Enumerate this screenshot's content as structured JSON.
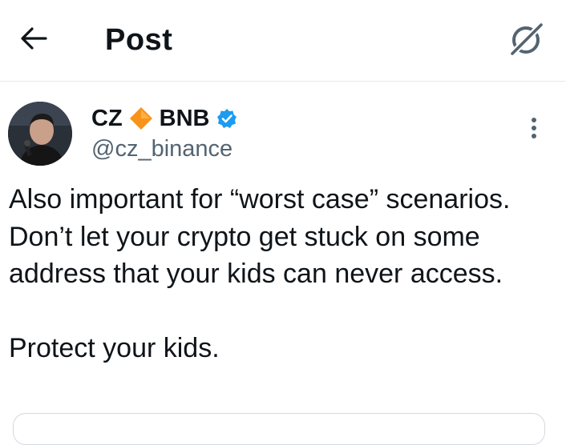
{
  "header": {
    "back_icon": "arrow-left-icon",
    "title": "Post",
    "grok_icon": "grok-icon"
  },
  "post": {
    "author": {
      "name_part1": "CZ",
      "emoji": "🔶",
      "name_part2": "BNB",
      "verified_icon": "verified-badge-icon",
      "handle": "@cz_binance"
    },
    "more_icon": "more-vertical-icon",
    "text": "Also important for “worst case” scenarios. Don’t let your crypto get stuck on some address that your kids can never access.\n\nProtect your kids."
  },
  "colors": {
    "text": "#0f1419",
    "secondary": "#536471",
    "verified": "#1d9bf0",
    "emoji_orange": "#f7931a",
    "divider": "#e6e9ec"
  }
}
